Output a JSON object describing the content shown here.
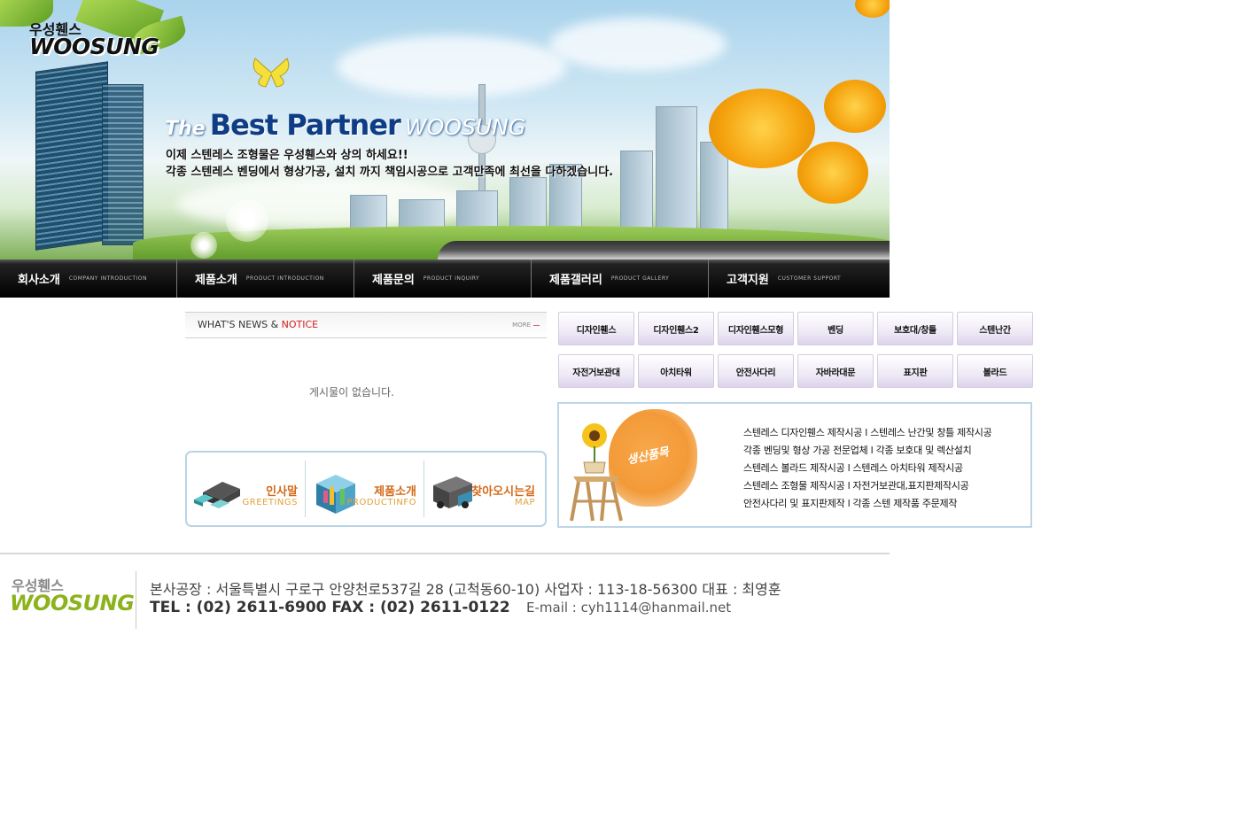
{
  "banner": {
    "logo_ko": "우성휀스",
    "logo_en": "WOOSUNG",
    "tagline_the": "The",
    "tagline_best": "Best Partner",
    "tagline_woo": "WOOSUNG",
    "slogan_1": "이제 스텐레스 조형물은  우성휀스와 상의 하세요!!",
    "slogan_2": "각종 스텐레스 벤딩에서 형상가공, 설치 까지 책임시공으로 고객만족에 최선을 다하겠습니다."
  },
  "nav": [
    {
      "ko": "회사소개",
      "en": "COMPANY INTRODUCTION"
    },
    {
      "ko": "제품소개",
      "en": "PRODUCT INTRODUCTION"
    },
    {
      "ko": "제품문의",
      "en": "PRODUCT INQUIRY"
    },
    {
      "ko": "제품갤러리",
      "en": "PRODUCT GALLERY"
    },
    {
      "ko": "고객지원",
      "en": "CUSTOMER SUPPORT"
    }
  ],
  "news": {
    "title_prefix": "WHAT'S NEWS & ",
    "title_red": "NOTICE",
    "more": "MORE",
    "empty": "게시물이 없습니다."
  },
  "quick": [
    {
      "ko": "인사말",
      "en": "GREETINGS"
    },
    {
      "ko": "제품소개",
      "en": "PRODUCTINFO"
    },
    {
      "ko": "찾아오시는길",
      "en": "MAP"
    }
  ],
  "categories_row1": [
    "디자인휀스",
    "디자인휀스2",
    "디자인휀스모형",
    "벤딩",
    "보호대/창틀",
    "스텐난간"
  ],
  "categories_row2": [
    "자전거보관대",
    "아치타워",
    "안전사다리",
    "자바라대문",
    "표지판",
    "볼라드"
  ],
  "products": {
    "badge": "생산품목",
    "lines": [
      "스텐레스 디자인휀스 제작시공 l 스텐레스 난간및 창틀 제작시공",
      "각종 벤딩및 형상 가공 전문업체 l 각종 보호대 및 렉산설치",
      "스텐레스 볼라드 제작시공 l 스텐레스 아치타워 제작시공",
      "스텐레스 조형물 제작시공 l 자전거보관대,표지판제작시공",
      "안전사다리 및 표지판제작 l 각종 스텐 제작품 주문제작"
    ]
  },
  "footer": {
    "logo_ko": "우성휀스",
    "logo_en": "WOOSUNG",
    "address": "본사공장 : 서울특별시 구로구 안양천로537길 28 (고척동60-10) 사업자 : 113-18-56300 대표 : 최영훈",
    "tel": "TEL : (02) 2611-6900 FAX : (02) 2611-0122",
    "email": "E-mail : cyh1114@hanmail.net"
  },
  "colors": {
    "nav_bg": "#000000",
    "notice_red": "#d21d1d",
    "quick_orange": "#d36a1a",
    "footer_green": "#8cb21c",
    "box_border": "#bcd6e8"
  }
}
